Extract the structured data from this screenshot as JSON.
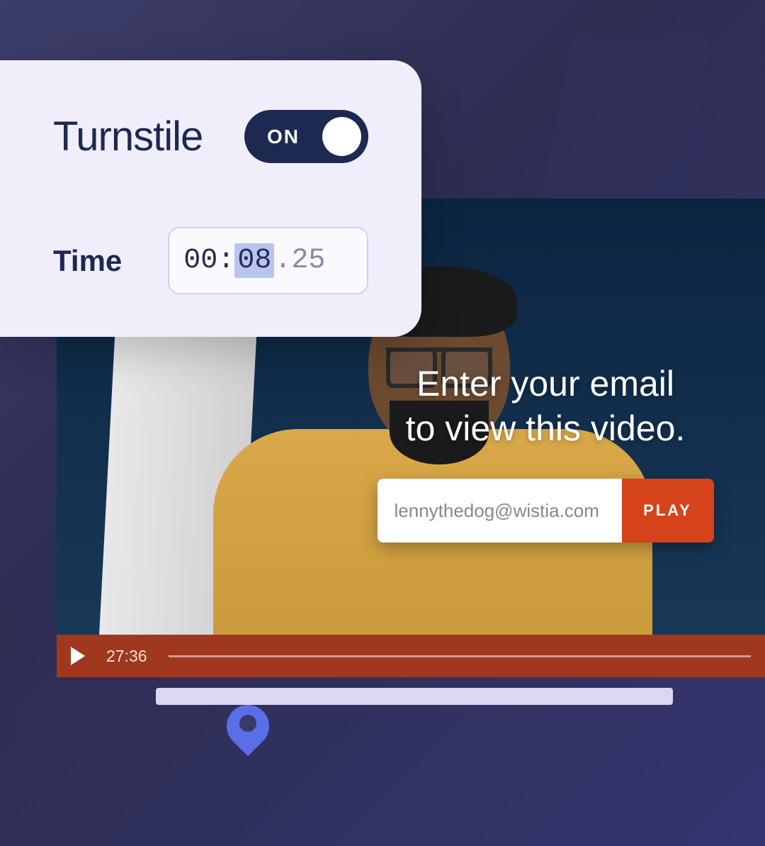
{
  "settings": {
    "title": "Turnstile",
    "toggle_state": "ON",
    "time_label": "Time",
    "time_minutes": "00",
    "time_seconds": "08",
    "time_frames": "25"
  },
  "gate": {
    "prompt_line1": "Enter your email",
    "prompt_line2": "to view this video.",
    "email_placeholder": "lennythedog@wistia.com",
    "play_label": "PLAY"
  },
  "player": {
    "duration": "27:36"
  },
  "colors": {
    "accent_orange": "#d6421a",
    "brand_navy": "#1e2951",
    "marker_blue": "#5b6ee8"
  }
}
